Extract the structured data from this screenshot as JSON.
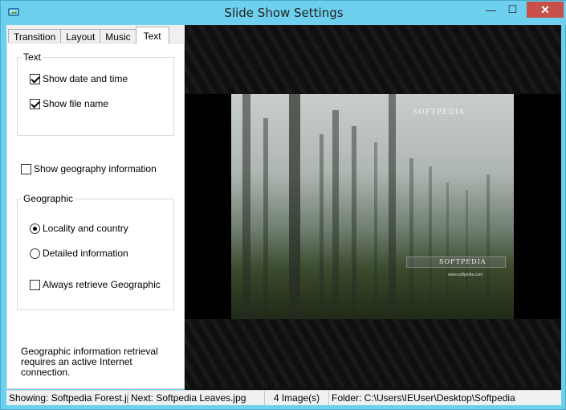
{
  "window": {
    "title": "Slide Show Settings",
    "controls": {
      "minimize": "—",
      "maximize": "☐",
      "close": "✕"
    }
  },
  "tabs": [
    "Transition",
    "Layout",
    "Music",
    "Text"
  ],
  "active_tab": "Text",
  "text_group": {
    "label": "Text",
    "options": [
      {
        "label": "Show date and time",
        "checked": true
      },
      {
        "label": "Show file name",
        "checked": true
      }
    ]
  },
  "show_geography": {
    "label": "Show geography information",
    "checked": false
  },
  "geographic_group": {
    "label": "Geographic",
    "radios": [
      {
        "label": "Locality and country",
        "checked": true
      },
      {
        "label": "Detailed information",
        "checked": false
      }
    ],
    "always_retrieve": {
      "label": "Always retrieve Geographic",
      "checked": false
    }
  },
  "note": {
    "line1": "Geographic information retrieval",
    "line2": "requires an active Internet connection."
  },
  "preview": {
    "watermark": "SOFTPEDIA",
    "badge": "SOFTPEDIA",
    "url": "www.softpedia.com"
  },
  "status": {
    "showing": "Showing: Softpedia Forest.jpg",
    "next": "Next: Softpedia Leaves.jpg",
    "count": "4 Image(s)",
    "folder": "Folder: C:\\Users\\IEUser\\Desktop\\Softpedia"
  },
  "colors": {
    "titlebar": "#6ecfee",
    "close": "#c7504a",
    "panel": "#f0f0f0",
    "preview": "#101010"
  },
  "icons": {
    "app": "slideshow-app-icon"
  }
}
